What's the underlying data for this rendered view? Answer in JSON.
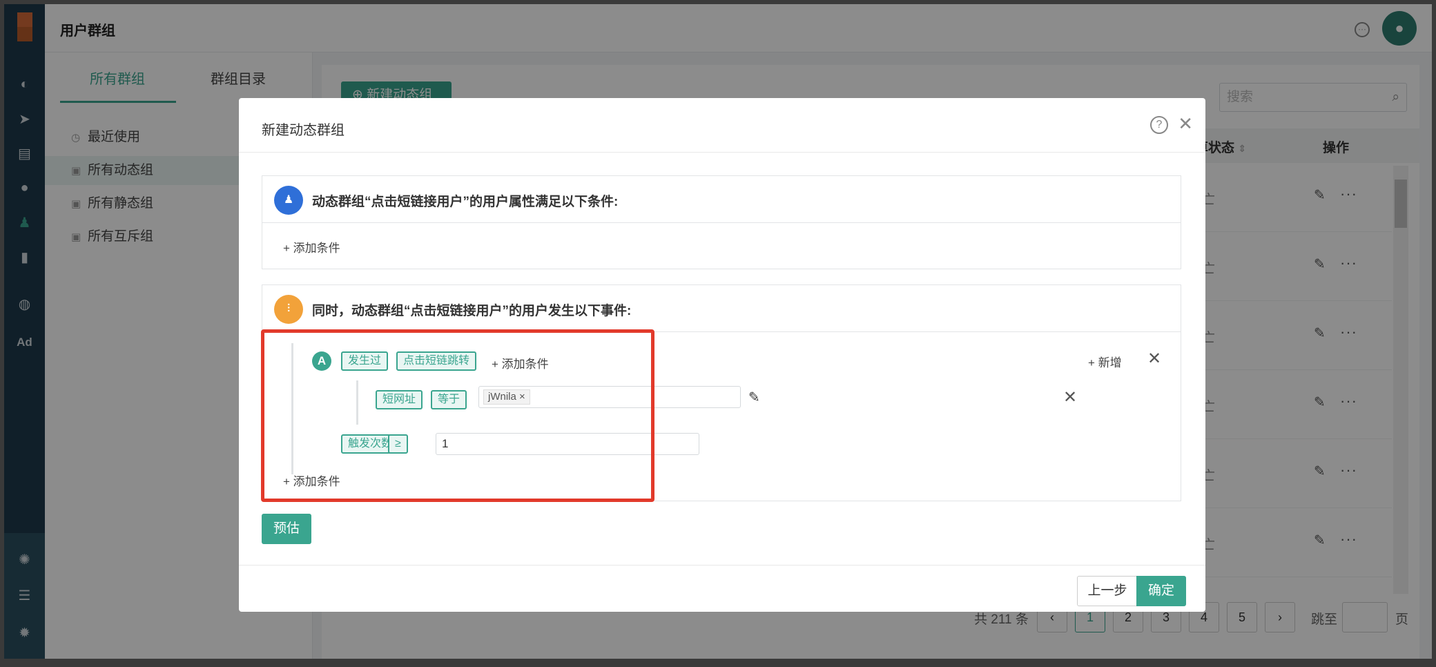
{
  "app": {
    "page_title": "用户群组",
    "rail": {
      "ad_label": "Ad"
    }
  },
  "left_panel": {
    "tabs": [
      {
        "label": "所有群组",
        "active": true
      },
      {
        "label": "群组目录",
        "active": false
      }
    ],
    "items": [
      {
        "label": "最近使用",
        "icon": "clock-icon",
        "active": false
      },
      {
        "label": "所有动态组",
        "icon": "folder-icon",
        "active": true
      },
      {
        "label": "所有静态组",
        "icon": "folder-icon",
        "active": false
      },
      {
        "label": "所有互斥组",
        "icon": "folder-icon",
        "active": false
      }
    ]
  },
  "main": {
    "new_button": "新建动态组",
    "search_placeholder": "搜索",
    "columns": {
      "status": "算状态",
      "ops": "操作"
    },
    "row_status_text": "亡",
    "pager": {
      "total": "共 211 条",
      "pages": [
        "1",
        "2",
        "3",
        "4",
        "5"
      ],
      "current": "1",
      "jump_label": "跳至",
      "page_label": "页"
    }
  },
  "modal": {
    "title": "新建动态群组",
    "section_user": {
      "title": "动态群组“点击短链接用户”的用户属性满足以下条件:",
      "add_condition": "+ 添加条件"
    },
    "section_event": {
      "title": "同时，动态群组“点击短链接用户”的用户发生以下事件:",
      "rule": {
        "marker": "A",
        "happened": "发生过",
        "event": "点击短链跳转",
        "add_condition": "+ 添加条件",
        "new": "+ 新增",
        "sub": {
          "property": "短网址",
          "operator": "等于",
          "value": "jWnila"
        },
        "count_label": "触发次数",
        "count_operator": "≥",
        "count_value": "1"
      },
      "add_condition": "+ 添加条件"
    },
    "estimate_button": "预估",
    "prev_button": "上一步",
    "ok_button": "确定"
  },
  "colors": {
    "accent": "#3aa58f",
    "highlight": "#e23a2b",
    "user_badge": "#2f6fd8",
    "event_badge": "#f2a23a"
  }
}
